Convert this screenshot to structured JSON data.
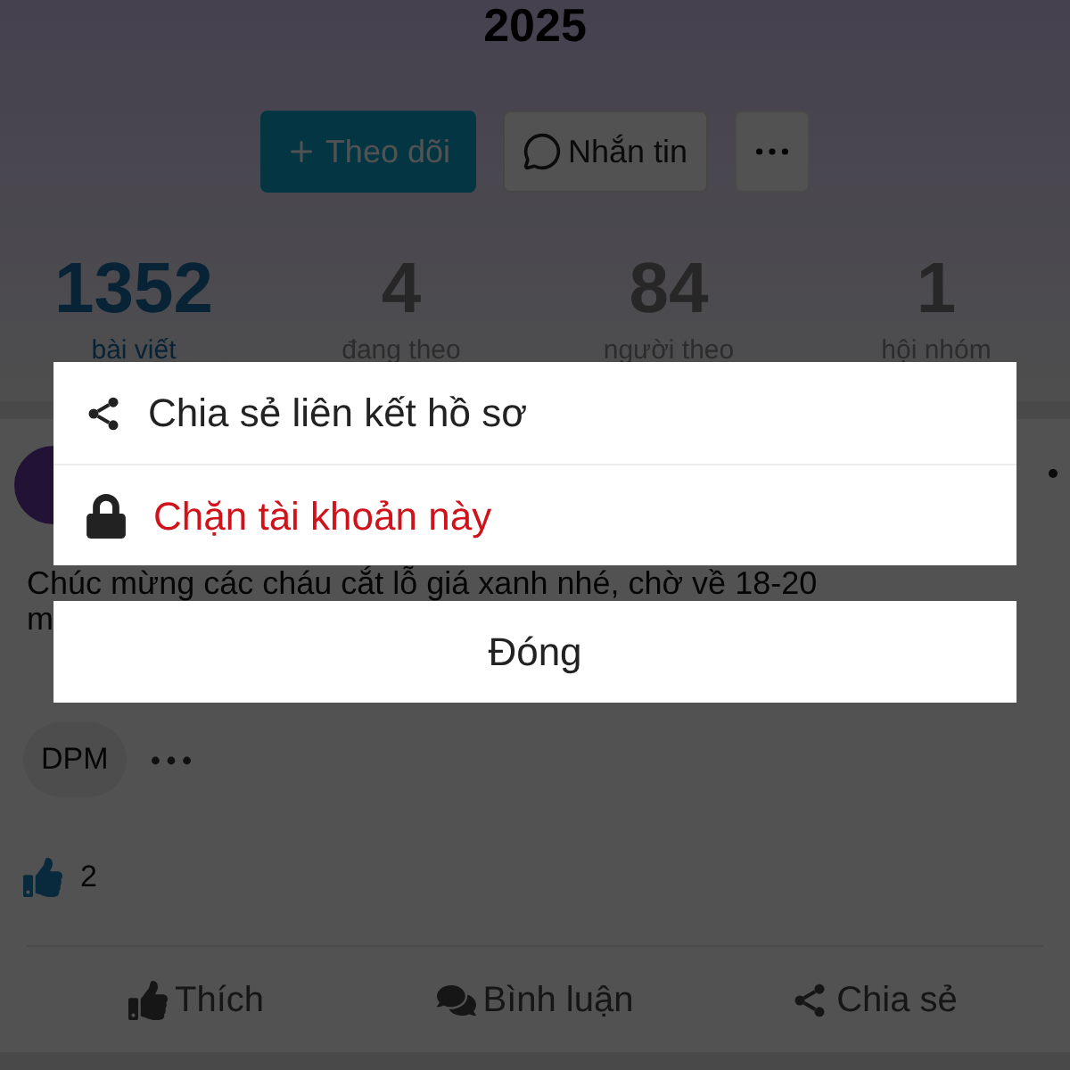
{
  "header": {
    "title": "2025"
  },
  "profile_actions": [
    {
      "kind": "follow",
      "label": "Theo dõi"
    },
    {
      "kind": "message",
      "label": "Nhắn tin"
    },
    {
      "kind": "more"
    }
  ],
  "stats": [
    {
      "value": "1352",
      "label": "bài viết",
      "selected": true
    },
    {
      "value": "4",
      "label": "đang theo",
      "selected": false
    },
    {
      "value": "84",
      "label": "người theo",
      "selected": false
    },
    {
      "value": "1",
      "label": "hội nhóm",
      "selected": false
    }
  ],
  "post": {
    "text": "Chúc mừng các cháu cắt lỗ giá xanh nhé, chờ về 18-20\nm",
    "tag": "DPM",
    "likes": "2",
    "actions": [
      {
        "kind": "like",
        "label": "Thích"
      },
      {
        "kind": "comment",
        "label": "Bình luận"
      },
      {
        "kind": "share",
        "label": "Chia sẻ"
      }
    ]
  },
  "sheet": {
    "options": [
      {
        "kind": "share",
        "label": "Chia sẻ liên kết hồ sơ"
      },
      {
        "kind": "block",
        "label": "Chặn tài khoản này"
      }
    ],
    "close": "Đóng"
  }
}
